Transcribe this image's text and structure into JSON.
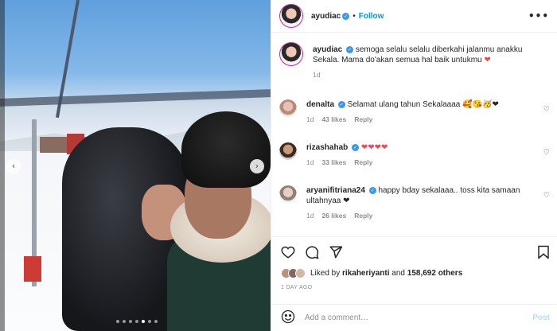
{
  "post": {
    "username": "ayudiac",
    "follow_label": "Follow",
    "separator": "•",
    "more_label": "•••"
  },
  "caption": {
    "username": "ayudiac",
    "text": "semoga selalu selalu diberkahi jalanmu anakku Sekala. Mama do'akan semua hal baik untukmu",
    "emoji": "❤",
    "time": "1d"
  },
  "comments": [
    {
      "username": "denalta",
      "text": "Selamat ulang tahun Sekalaaaa 🥰😘🥳❤",
      "time": "1d",
      "likes": "43 likes",
      "reply": "Reply"
    },
    {
      "username": "rizashahab",
      "text": "❤❤❤❤",
      "time": "1d",
      "likes": "33 likes",
      "reply": "Reply"
    },
    {
      "username": "aryanifitriana24",
      "text": "happy bday sekalaaa.. toss kita samaan ultahnyaa ❤",
      "time": "1d",
      "likes": "26 likes",
      "reply": "Reply"
    }
  ],
  "likes": {
    "prefix": "Liked by",
    "user": "rikaheriyanti",
    "conj": "and",
    "count": "158,692 others"
  },
  "date": "1 DAY AGO",
  "add_comment": {
    "placeholder": "Add a comment…",
    "post_label": "Post"
  },
  "carousel": {
    "slides": 7,
    "active_index": 4
  },
  "colors": {
    "accent": "#0095f6",
    "heart": "#ed4956",
    "muted": "#8e8e8e"
  },
  "icons": {
    "actions": [
      "heart-icon",
      "comment-icon",
      "share-icon",
      "bookmark-icon"
    ],
    "nav": [
      "chevron-left-icon",
      "chevron-right-icon"
    ]
  }
}
